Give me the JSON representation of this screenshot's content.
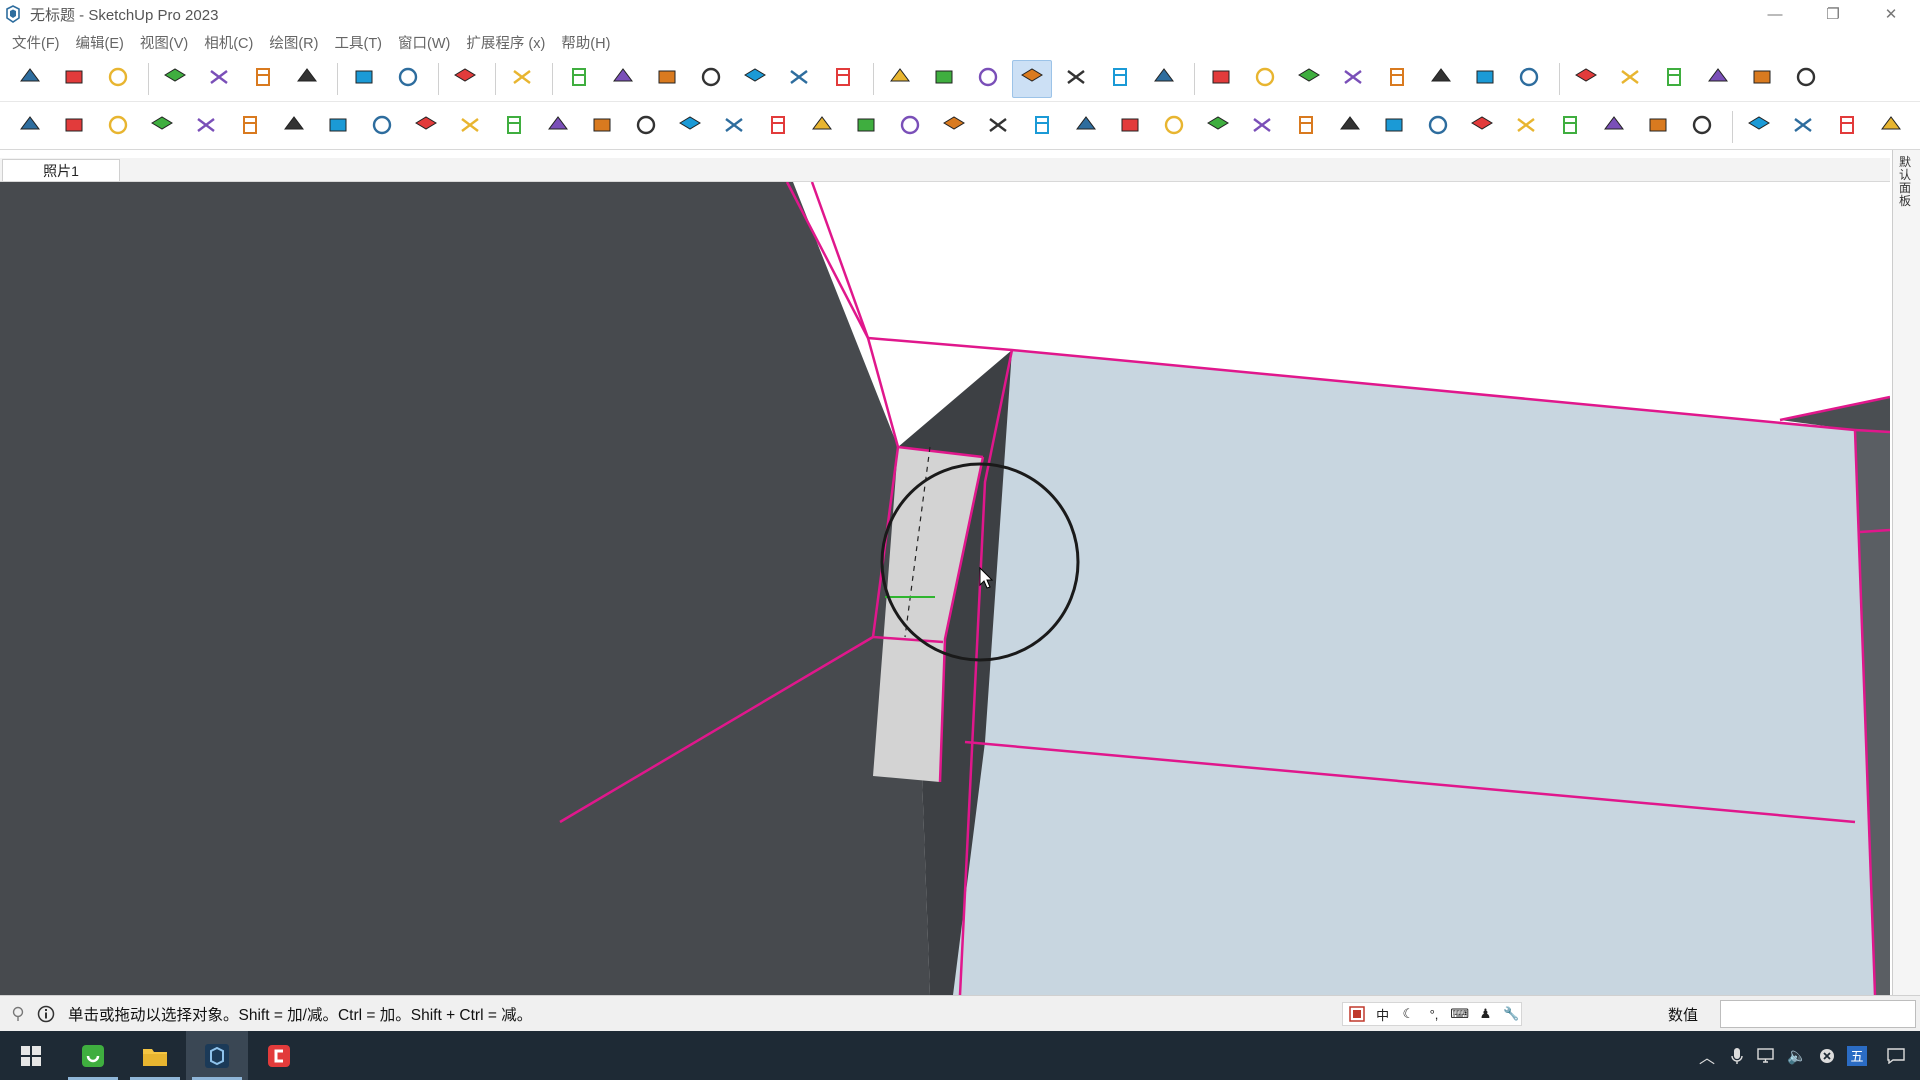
{
  "window": {
    "title": "无标题 - SketchUp Pro 2023",
    "controls": {
      "minimize": "—",
      "restore": "❐",
      "close": "✕"
    }
  },
  "menu": {
    "items": [
      "文件(F)",
      "编辑(E)",
      "视图(V)",
      "相机(C)",
      "绘图(R)",
      "工具(T)",
      "窗口(W)",
      "扩展程序 (x)",
      "帮助(H)"
    ]
  },
  "toolbar_row1": {
    "groups": [
      [
        "new-icon",
        "open-icon",
        "save-icon"
      ],
      [
        "cut-icon",
        "copy-icon",
        "paste-icon",
        "erase-icon"
      ],
      [
        "undo-icon",
        "redo-icon"
      ],
      [
        "print-icon"
      ],
      [
        "model-info-icon"
      ],
      [
        "iso-view-icon",
        "top-view-icon",
        "front-view-icon",
        "right-view-icon",
        "back-view-icon",
        "left-view-icon",
        "bottom-view-icon"
      ],
      [
        "xray-icon",
        "back-edges-icon",
        "wireframe-icon",
        "hidden-line-icon",
        "shaded-icon",
        "shaded-textures-icon",
        "monochrome-icon"
      ],
      [
        "section-plane-icon",
        "push-pull-up-icon",
        "push-pull-icon",
        "dimension-icon",
        "solid-tool-icon",
        "rotate-left-icon",
        "rotate-right-icon",
        "paint-icon"
      ],
      [
        "component-1-icon",
        "component-2-icon",
        "component-3-icon",
        "component-4-icon",
        "component-5-icon",
        "component-6-icon"
      ]
    ],
    "active": "hidden-line-icon"
  },
  "toolbar_row2": {
    "groups": [
      [
        "ext-1-icon",
        "ext-2-icon",
        "ext-3-icon",
        "ext-4-icon",
        "ext-5-icon",
        "ext-6-icon",
        "ext-7-icon",
        "ext-8-icon",
        "ext-9-icon",
        "ext-10-icon",
        "ext-11-icon",
        "ext-12-icon",
        "ext-13-icon",
        "ext-14-icon",
        "ext-15-icon",
        "ext-16-icon",
        "ext-17-icon",
        "ext-18-icon",
        "ext-19-icon",
        "ext-20-icon",
        "ext-21-icon",
        "ext-22-icon",
        "ext-23-icon",
        "ext-24-icon",
        "ext-25-icon",
        "ext-26-icon",
        "ext-27-icon",
        "ext-28-icon",
        "ext-29-icon",
        "ext-30-icon",
        "ext-31-icon",
        "ext-32-icon",
        "ext-33-icon",
        "ext-34-icon",
        "ext-35-icon",
        "ext-36-icon",
        "ext-37-icon",
        "ext-38-icon",
        "ext-39-icon"
      ],
      [
        "curve-1-icon",
        "curve-2-icon",
        "curve-3-icon",
        "curve-4-icon"
      ]
    ]
  },
  "scene": {
    "tabs": [
      "照片1"
    ]
  },
  "tray": {
    "label": "默认面板"
  },
  "status": {
    "hint": "单击或拖动以选择对象。Shift = 加/减。Ctrl = 加。Shift + Ctrl = 减。",
    "ime": {
      "lang": "中",
      "items": [
        "ime-icon",
        "moon-icon",
        "punct-icon",
        "keyboard-icon",
        "user-icon",
        "wrench-icon"
      ]
    },
    "vcb_label": "数值",
    "vcb_value": ""
  },
  "taskbar": {
    "apps": [
      "start-icon",
      "app-green-icon",
      "explorer-icon",
      "sketchup-icon",
      "red-app-icon"
    ],
    "active": "sketchup-icon",
    "tray": [
      "chevron-up-icon",
      "mic-icon",
      "network-icon",
      "volume-icon",
      "close-circle-icon",
      "ime-five-icon",
      "notification-icon"
    ],
    "ime_five": "五"
  },
  "colors": {
    "accent_magenta": "#e0178c",
    "dark_face": "#474a4e",
    "light_face": "#c8d6e0",
    "gray_face": "#d3d3d3",
    "toolbar_active": "#cce0f5"
  }
}
